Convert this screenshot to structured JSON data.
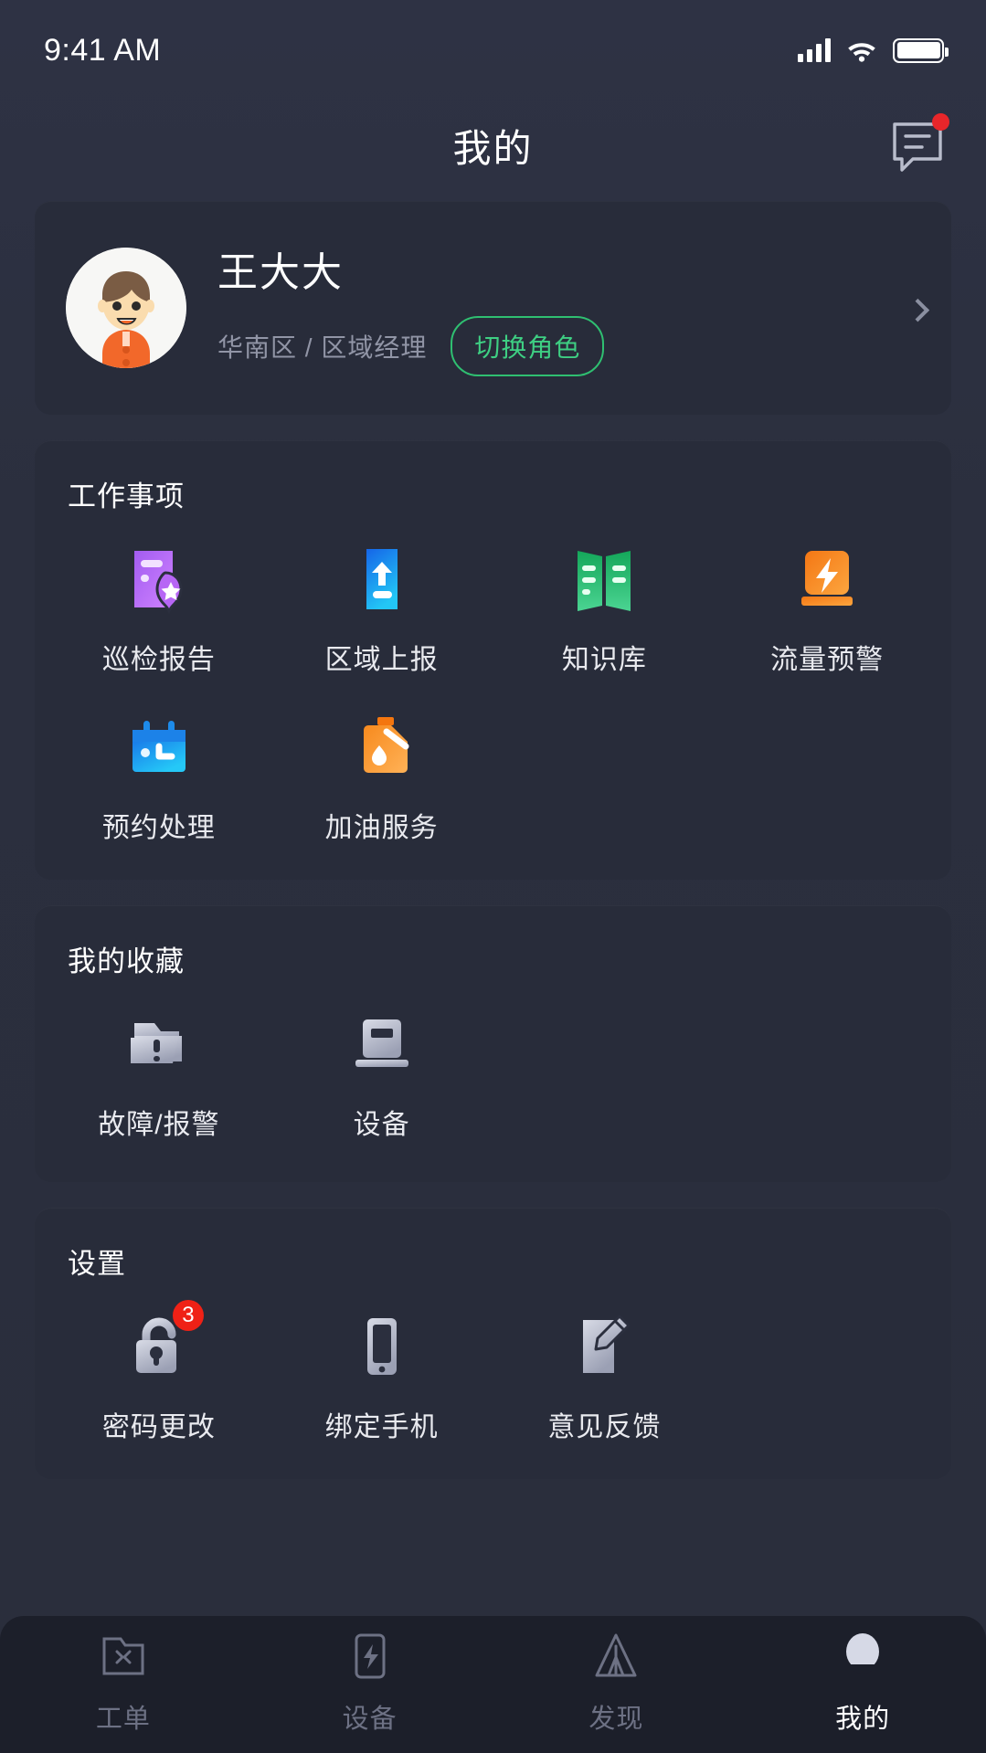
{
  "status_bar": {
    "time": "9:41 AM",
    "signal_icon": "signal-bars-icon",
    "wifi_icon": "wifi-icon",
    "battery_icon": "battery-full-icon"
  },
  "header": {
    "title": "我的",
    "message_icon": "message-icon",
    "has_unread_dot": true
  },
  "profile": {
    "name": "王大大",
    "subtitle": "华南区 / 区域经理",
    "role_switch_label": "切换角色",
    "avatar_icon": "avatar",
    "chevron_icon": "chevron-right-icon"
  },
  "work_section": {
    "title": "工作事项",
    "items": [
      {
        "label": "巡检报告",
        "icon": "inspection-report-icon"
      },
      {
        "label": "区域上报",
        "icon": "region-upload-icon"
      },
      {
        "label": "知识库",
        "icon": "knowledge-book-icon"
      },
      {
        "label": "流量预警",
        "icon": "flow-alert-icon"
      },
      {
        "label": "预约处理",
        "icon": "appointment-calendar-icon"
      },
      {
        "label": "加油服务",
        "icon": "refuel-service-icon"
      }
    ]
  },
  "favorites_section": {
    "title": "我的收藏",
    "items": [
      {
        "label": "故障/报警",
        "icon": "fault-alarm-folder-icon"
      },
      {
        "label": "设备",
        "icon": "device-icon"
      }
    ]
  },
  "settings_section": {
    "title": "设置",
    "items": [
      {
        "label": "密码更改",
        "icon": "unlock-padlock-icon",
        "badge": "3"
      },
      {
        "label": "绑定手机",
        "icon": "phone-icon",
        "badge": ""
      },
      {
        "label": "意见反馈",
        "icon": "feedback-pencil-icon",
        "badge": ""
      }
    ]
  },
  "tabbar": {
    "tabs": [
      {
        "label": "工单",
        "icon": "work-order-icon",
        "active": false
      },
      {
        "label": "设备",
        "icon": "device-bolt-icon",
        "active": false
      },
      {
        "label": "发现",
        "icon": "discover-compass-icon",
        "active": false
      },
      {
        "label": "我的",
        "icon": "profile-person-icon",
        "active": true
      }
    ]
  },
  "colors": {
    "page_bg": "#2b2f3e",
    "card_bg": "#282c3a",
    "tabbar_bg": "#1c1f2a",
    "accent_green": "#3ecf83",
    "badge_red": "#ef2116",
    "text_primary": "#ffffff",
    "text_muted": "#9195a6"
  }
}
